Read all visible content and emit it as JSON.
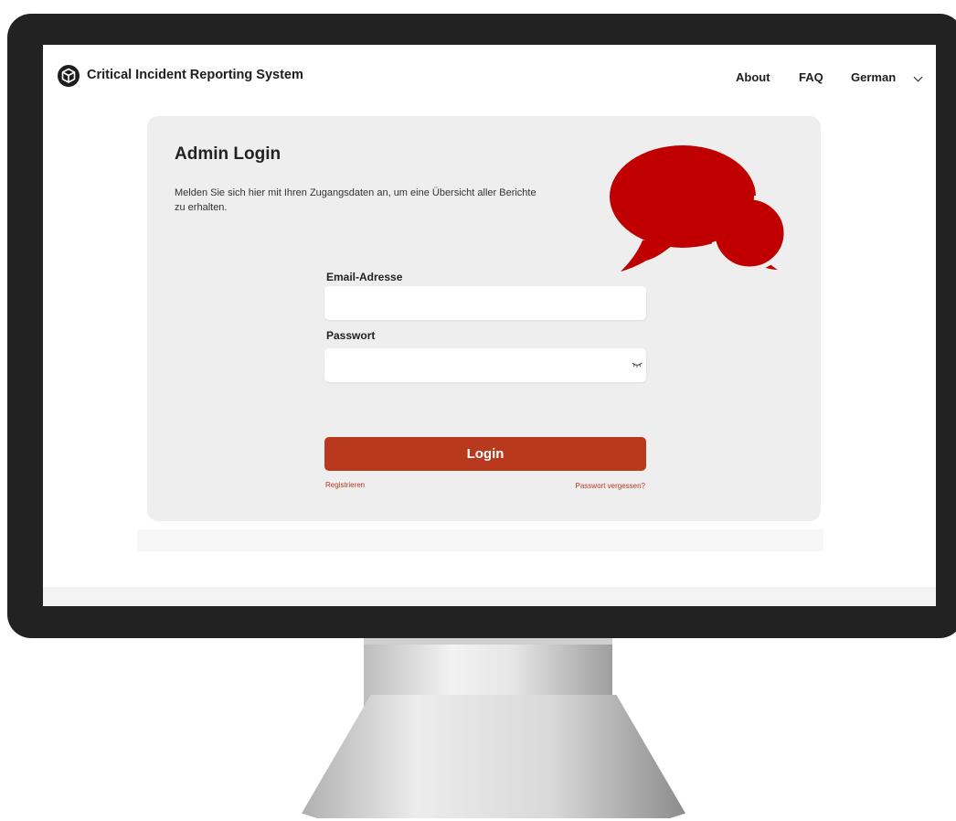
{
  "header": {
    "title": "Critical Incident Reporting System",
    "logo_icon": "cube-icon",
    "nav": {
      "about": "About",
      "faq": "FAQ",
      "language": "German"
    }
  },
  "login": {
    "title": "Admin Login",
    "description": "Melden Sie sich hier mit Ihren Zugangsdaten an, um eine Übersicht aller Berichte zu erhalten.",
    "email_label": "Email-Adresse",
    "email_value": "",
    "password_label": "Passwort",
    "password_value": "",
    "password_toggle_icon": "eye-closed-icon",
    "button_label": "Login",
    "register_link": "Registrieren",
    "forgot_link": "Passwort vergessen?",
    "illustration": "speech-bubbles-icon"
  },
  "colors": {
    "accent": "#b8391d",
    "bubbles": "#c00000",
    "card_background": "#eeeeee",
    "bezel": "#222222"
  }
}
